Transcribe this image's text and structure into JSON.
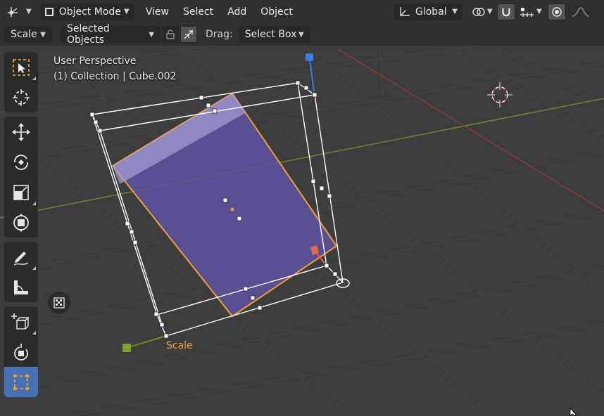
{
  "header": {
    "mode_label": "Object Mode",
    "menu": {
      "view": "View",
      "select": "Select",
      "add": "Add",
      "object": "Object"
    },
    "orientation_label": "Global"
  },
  "tool_options": {
    "transform_label": "Scale",
    "pivot_label": "Selected Objects",
    "drag_label": "Drag:",
    "drag_value": "Select Box"
  },
  "viewport": {
    "perspective_label": "User Perspective",
    "collection_label": "(1) Collection | Cube.002",
    "gizmo_label": "Scale"
  },
  "colors": {
    "accent": "#4772b3",
    "selection_outline": "#f29c39",
    "object_fill": "#5c52a0",
    "x_axis": "#8c3a3a",
    "y_axis": "#6a8a2a",
    "z_handle": "#3a7ee0"
  },
  "toolbar_icons": [
    "select-box-icon",
    "cursor-icon",
    "move-icon",
    "rotate-icon",
    "scale-icon",
    "transform-icon",
    "annotate-icon",
    "measure-icon",
    "add-cube-icon",
    "spin-icon",
    "cage-scale-icon"
  ]
}
